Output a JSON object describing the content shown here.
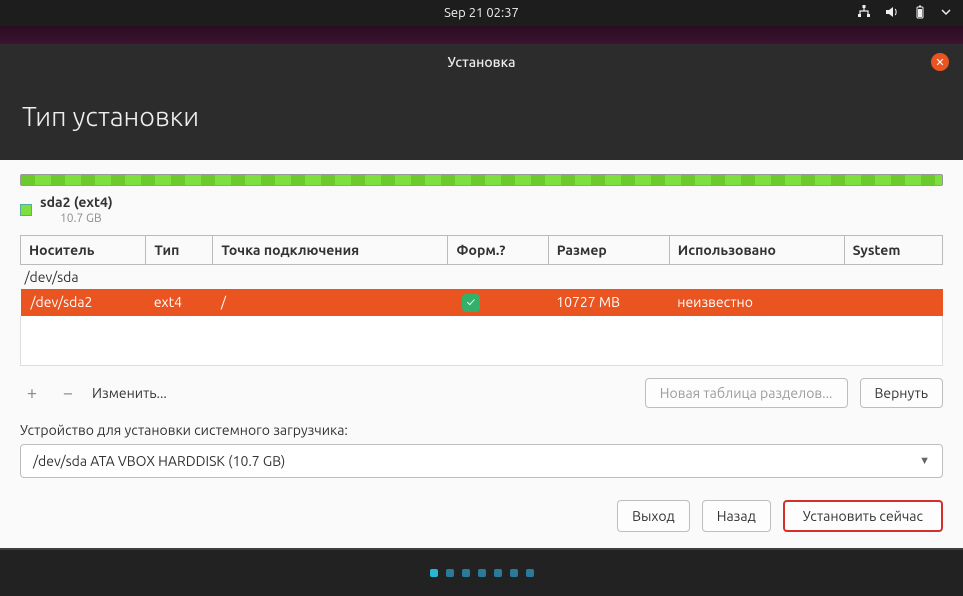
{
  "topbar": {
    "datetime": "Sep 21  02:37"
  },
  "installer": {
    "window_title": "Установка",
    "page_title": "Тип установки"
  },
  "partition": {
    "legend_label": "sda2 (ext4)",
    "legend_size": "10.7 GB",
    "columns": {
      "device": "Носитель",
      "type": "Тип",
      "mount": "Точка подключения",
      "format": "Форм.?",
      "size": "Размер",
      "used": "Использовано",
      "system": "System"
    },
    "disk_row": {
      "device": "/dev/sda"
    },
    "rows": [
      {
        "device": "/dev/sda2",
        "type": "ext4",
        "mount": "/",
        "format": true,
        "size": "10727 MB",
        "used": "неизвестно",
        "system": ""
      }
    ],
    "tools": {
      "add": "+",
      "remove": "−",
      "change": "Изменить...",
      "new_table": "Новая таблица разделов...",
      "revert": "Вернуть"
    }
  },
  "bootloader": {
    "label": "Устройство для установки системного загрузчика:",
    "selected": "/dev/sda   ATA VBOX HARDDISK (10.7 GB)"
  },
  "nav": {
    "quit": "Выход",
    "back": "Назад",
    "install": "Установить сейчас"
  }
}
